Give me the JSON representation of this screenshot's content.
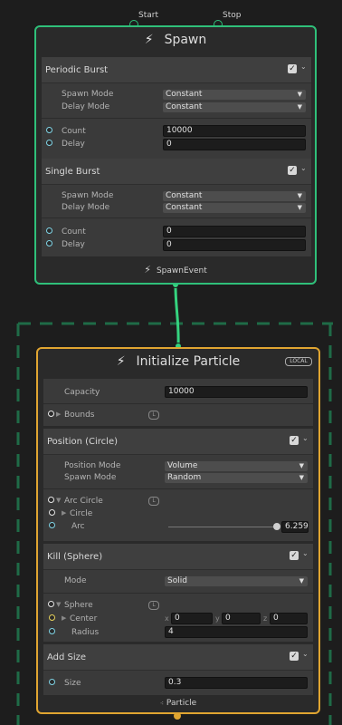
{
  "spawn": {
    "port_start": "Start",
    "port_stop": "Stop",
    "title": "Spawn",
    "periodic": {
      "title": "Periodic Burst",
      "spawn_mode_label": "Spawn Mode",
      "spawn_mode_value": "Constant",
      "delay_mode_label": "Delay Mode",
      "delay_mode_value": "Constant",
      "count_label": "Count",
      "count_value": "10000",
      "delay_label": "Delay",
      "delay_value": "0"
    },
    "single": {
      "title": "Single Burst",
      "spawn_mode_label": "Spawn Mode",
      "spawn_mode_value": "Constant",
      "delay_mode_label": "Delay Mode",
      "delay_mode_value": "Constant",
      "count_label": "Count",
      "count_value": "0",
      "delay_label": "Delay",
      "delay_value": "0"
    },
    "output_label": "SpawnEvent"
  },
  "init": {
    "title": "Initialize Particle",
    "space_badge": "LOCAL",
    "capacity_label": "Capacity",
    "capacity_value": "10000",
    "bounds_label": "Bounds",
    "local_badge": "L",
    "position": {
      "title": "Position (Circle)",
      "position_mode_label": "Position Mode",
      "position_mode_value": "Volume",
      "spawn_mode_label": "Spawn Mode",
      "spawn_mode_value": "Random",
      "arc_circle_label": "Arc Circle",
      "circle_label": "Circle",
      "arc_label": "Arc",
      "arc_value": "6.259",
      "arc_fraction": 0.996
    },
    "kill": {
      "title": "Kill (Sphere)",
      "mode_label": "Mode",
      "mode_value": "Solid",
      "sphere_label": "Sphere",
      "center_label": "Center",
      "x_label": "x",
      "x_value": "0",
      "y_label": "y",
      "y_value": "0",
      "z_label": "z",
      "z_value": "0",
      "radius_label": "Radius",
      "radius_value": "4"
    },
    "size": {
      "title": "Add Size",
      "size_label": "Size",
      "size_value": "0.3"
    },
    "output_label": "Particle"
  },
  "icons": {
    "bolt": "⚡",
    "check": "✓",
    "chevron": "⌄",
    "dropdown_arrow": "▼",
    "expand": "▶",
    "collapse": "▼"
  },
  "colors": {
    "spawn_border": "#2fc07a",
    "init_border": "#e0a531",
    "flow_link": "#35d37f",
    "group_dash": "#1f6b47"
  }
}
